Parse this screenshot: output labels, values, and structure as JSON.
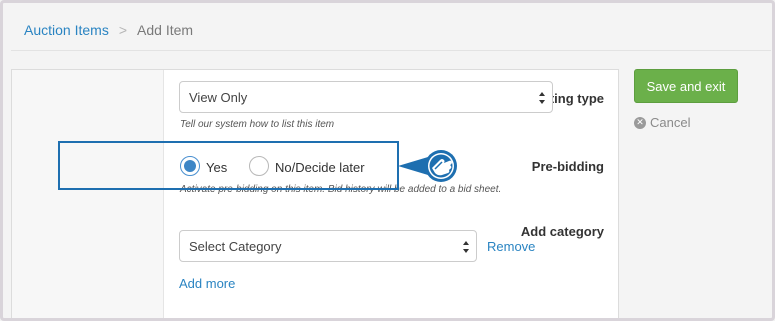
{
  "breadcrumb": {
    "parent": "Auction Items",
    "separator": ">",
    "current": "Add Item"
  },
  "form": {
    "listing_type": {
      "label": "Listing type",
      "value": "View Only",
      "help": "Tell our system how to list this item"
    },
    "pre_bidding": {
      "label": "Pre-bidding",
      "options": [
        {
          "label": "Yes",
          "checked": true
        },
        {
          "label": "No/Decide later",
          "checked": false
        }
      ],
      "help": "Activate pre-bidding on this item. Bid history will be added to a bid sheet."
    },
    "category": {
      "label": "Add category",
      "placeholder": "Select Category",
      "remove": "Remove",
      "add_more": "Add more"
    }
  },
  "actions": {
    "save": "Save and exit",
    "cancel": "Cancel",
    "cancel_icon": "close-circle-icon"
  },
  "colors": {
    "accent": "#2a84c2",
    "save": "#6bb04a",
    "highlight": "#1e6fb0"
  },
  "callout_icon": "pointing-hand-icon"
}
